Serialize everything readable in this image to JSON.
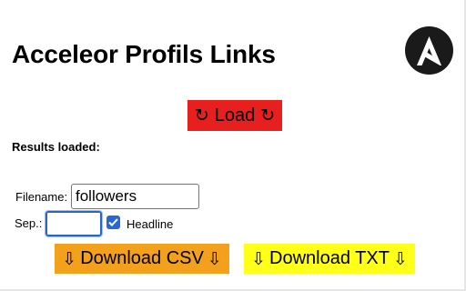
{
  "page": {
    "title": "Acceleor Profils Links",
    "results_label": "Results loaded:"
  },
  "load_button": {
    "icon_left": "↻",
    "label": "Load",
    "icon_right": "↻",
    "color": "#e81f1f"
  },
  "form": {
    "filename_label": "Filename:",
    "filename_value": "followers",
    "separator_label": "Sep.:",
    "separator_value": "",
    "headline_label": "Headline",
    "headline_checked": true
  },
  "download_csv": {
    "icon_left": "⇩",
    "label": "Download CSV",
    "icon_right": "⇩",
    "color": "#f3a11d"
  },
  "download_txt": {
    "icon_left": "⇩",
    "label": "Download TXT",
    "icon_right": "⇩",
    "color": "#ffff1a"
  },
  "logo": {
    "icon": "ansible-logo-icon",
    "color": "#1a1a1a"
  }
}
